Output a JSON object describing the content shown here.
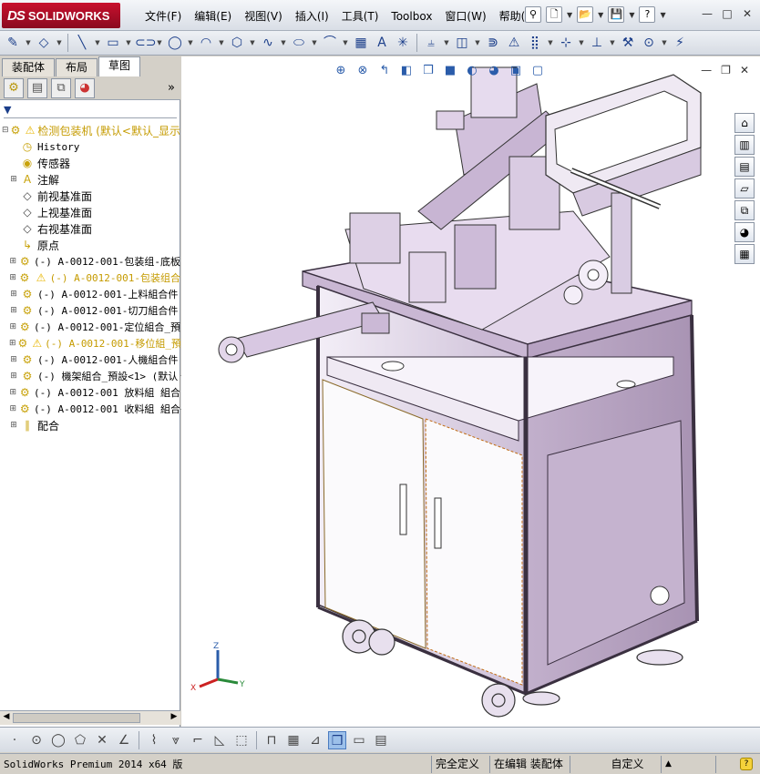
{
  "app": {
    "logo_text": "SOLIDWORKS",
    "logo_mark": "DS",
    "menus": [
      "文件(F)",
      "编辑(E)",
      "视图(V)",
      "插入(I)",
      "工具(T)",
      "Toolbox",
      "窗口(W)",
      "帮助(H)"
    ],
    "window_buttons": [
      "—",
      "□",
      "✕"
    ]
  },
  "toolbar": {
    "icons": [
      "sketch-icon",
      "smart-dimension-icon",
      "line-icon",
      "rectangle-icon",
      "slot-icon",
      "circle-icon",
      "arc-icon",
      "spline-icon",
      "ellipse-icon",
      "fillet-icon",
      "construction-line-icon",
      "text-icon",
      "point-icon",
      "mirror-icon",
      "offset-icon",
      "trim-icon",
      "convert-icon",
      "linear-pattern-icon",
      "move-icon",
      "relations-icon",
      "repair-icon",
      "quick-snaps-icon",
      "rapid-sketch-icon"
    ]
  },
  "panel": {
    "tabs": [
      "装配体",
      "布局",
      "草图"
    ],
    "active_tab": 2,
    "pm_icons": [
      "feature-manager-icon",
      "property-manager-icon",
      "configuration-manager-icon",
      "display-manager-icon"
    ],
    "more": "»",
    "filter_icon": "filter-icon",
    "tree": [
      {
        "label": "检测包装机  (默认<默认_显示",
        "icon": "assembly-icon",
        "warn": true,
        "expand": "−",
        "indent": 0
      },
      {
        "label": "History",
        "icon": "history-icon",
        "expand": "",
        "indent": 1
      },
      {
        "label": "传感器",
        "icon": "sensor-icon",
        "expand": "",
        "indent": 1
      },
      {
        "label": "注解",
        "icon": "annotation-icon",
        "expand": "+",
        "indent": 1
      },
      {
        "label": "前视基准面",
        "icon": "plane-icon",
        "expand": "",
        "indent": 1
      },
      {
        "label": "上视基准面",
        "icon": "plane-icon",
        "expand": "",
        "indent": 1
      },
      {
        "label": "右视基准面",
        "icon": "plane-icon",
        "expand": "",
        "indent": 1
      },
      {
        "label": "原点",
        "icon": "origin-icon",
        "expand": "",
        "indent": 1
      },
      {
        "label": "(-) A-0012-001-包装组-底板",
        "icon": "subassembly-icon",
        "expand": "+",
        "indent": 1
      },
      {
        "label": "(-) A-0012-001-包装组合",
        "icon": "subassembly-icon",
        "warn": true,
        "expand": "+",
        "indent": 1
      },
      {
        "label": "(-) A-0012-001-上料組合件",
        "icon": "subassembly-icon",
        "expand": "+",
        "indent": 1
      },
      {
        "label": "(-) A-0012-001-切刀組合件",
        "icon": "subassembly-icon",
        "expand": "+",
        "indent": 1
      },
      {
        "label": "(-) A-0012-001-定位組合_預",
        "icon": "subassembly-icon",
        "expand": "+",
        "indent": 1
      },
      {
        "label": "(-) A-0012-001-移位組_預",
        "icon": "subassembly-icon",
        "warn": true,
        "expand": "+",
        "indent": 1
      },
      {
        "label": "(-) A-0012-001-人機組合件",
        "icon": "subassembly-icon",
        "expand": "+",
        "indent": 1
      },
      {
        "label": "(-) 機架組合_預設<1> (默认",
        "icon": "subassembly-icon",
        "expand": "+",
        "indent": 1
      },
      {
        "label": "(-) A-0012-001 放料組 組合",
        "icon": "subassembly-icon",
        "expand": "+",
        "indent": 1
      },
      {
        "label": "(-) A-0012-001 收料組 組合",
        "icon": "subassembly-icon",
        "expand": "+",
        "indent": 1
      },
      {
        "label": "配合",
        "icon": "mates-icon",
        "expand": "+",
        "indent": 1
      }
    ]
  },
  "graphics": {
    "headsup_icons": [
      "zoom-to-fit-icon",
      "zoom-area-icon",
      "previous-view-icon",
      "section-view-icon",
      "view-orientation-icon",
      "display-style-icon",
      "hide-show-icon",
      "edit-appearance-icon",
      "apply-scene-icon",
      "view-settings-icon"
    ],
    "view_buttons": [
      "—",
      "❐",
      "✕"
    ],
    "taskpane_icons": [
      "home-icon",
      "resources-icon",
      "design-library-icon",
      "file-explorer-icon",
      "view-palette-icon",
      "appearances-icon",
      "custom-properties-icon"
    ],
    "triad": {
      "x": "X",
      "y": "Y",
      "z": "Z"
    }
  },
  "sketchbar": {
    "icons": [
      "dot-icon",
      "point-icon",
      "circle-icon",
      "polygon-icon",
      "trim-icon",
      "angle-icon",
      "centerline-icon",
      "curve-icon",
      "chamfer-icon",
      "corner-icon",
      "sketch-text-icon",
      "dimension-icon",
      "grid-icon",
      "view-icon",
      "shaded-icon",
      "hidden-lines-icon",
      "wireframe-icon"
    ]
  },
  "status": {
    "version": "SolidWorks Premium 2014 x64 版",
    "defined": "完全定义",
    "editing": "在编辑 装配体",
    "units": "自定义",
    "up": "▲",
    "help": "?"
  }
}
